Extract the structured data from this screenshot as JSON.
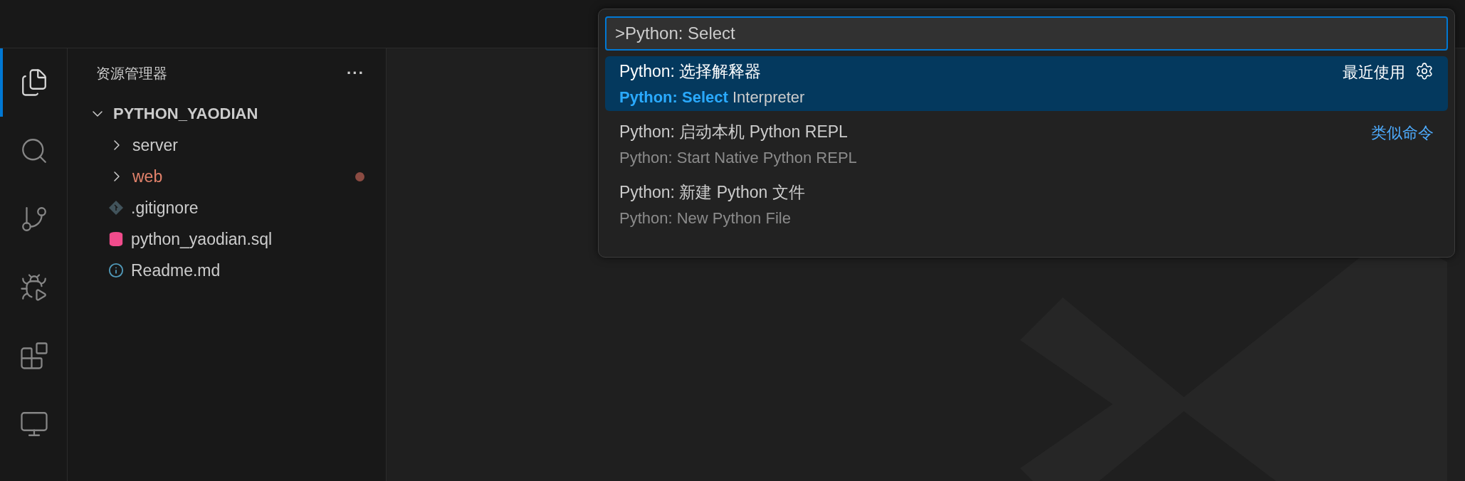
{
  "activity_bar": {
    "items": [
      {
        "kind": "explorer",
        "selected": true
      },
      {
        "kind": "search",
        "selected": false
      },
      {
        "kind": "source_control",
        "selected": false
      },
      {
        "kind": "run_debug",
        "selected": false
      },
      {
        "kind": "extensions",
        "selected": false
      },
      {
        "kind": "remote",
        "selected": false
      }
    ]
  },
  "sidebar": {
    "title": "资源管理器",
    "more": "···",
    "tree": [
      {
        "label": "PYTHON_YAODIAN",
        "expanded": true,
        "children": [
          {
            "label": "server",
            "kind": "folder",
            "expanded": false,
            "modified": false
          },
          {
            "label": "web",
            "kind": "folder",
            "expanded": false,
            "modified": true
          },
          {
            "label": ".gitignore",
            "kind": "git",
            "modified": false
          },
          {
            "label": "python_yaodian.sql",
            "kind": "database",
            "modified": false
          },
          {
            "label": "Readme.md",
            "kind": "info",
            "modified": false
          }
        ]
      }
    ]
  },
  "command_palette": {
    "value": ">Python: Select",
    "items": [
      {
        "label": "Python: 选择解释器",
        "detail": "**Python: Select** Interpreter",
        "badge": "最近使用",
        "settings": true,
        "selected": true
      },
      {
        "label": "Python: 启动本机 Python REPL",
        "detail": "Python: Start Native Python REPL",
        "link": "类似命令",
        "selected": false
      },
      {
        "label": "Python: 新建 Python 文件",
        "detail": "Python: New Python File",
        "selected": false
      }
    ]
  }
}
